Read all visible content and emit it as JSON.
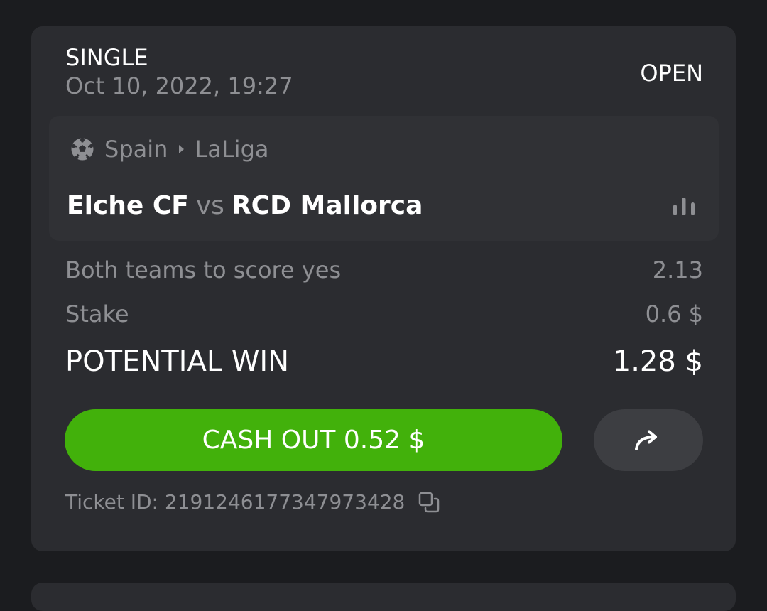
{
  "bet": {
    "type": "SINGLE",
    "datetime": "Oct 10, 2022, 19:27",
    "status": "OPEN"
  },
  "event": {
    "sport_icon": "soccer-ball-icon",
    "country": "Spain",
    "league": "LaLiga",
    "home_team": "Elche CF",
    "vs": "vs",
    "away_team": "RCD Mallorca",
    "stats_icon": "bar-chart-icon"
  },
  "selection": {
    "market": "Both teams to score yes",
    "odds": "2.13"
  },
  "stake": {
    "label": "Stake",
    "value": "0.6 $"
  },
  "potential_win": {
    "label": "POTENTIAL WIN",
    "value": "1.28 $"
  },
  "actions": {
    "cashout_label": "CASH OUT 0.52 $",
    "share_icon": "share-arrow-icon"
  },
  "ticket": {
    "label": "Ticket ID: 2191246177347973428",
    "copy_icon": "copy-icon"
  },
  "colors": {
    "background": "#1b1c1f",
    "card": "#2b2c30",
    "event_box": "#303135",
    "cashout": "#42b10b",
    "share_button": "#3d3e42",
    "muted_text": "#8e8f93",
    "text": "#ffffff"
  }
}
